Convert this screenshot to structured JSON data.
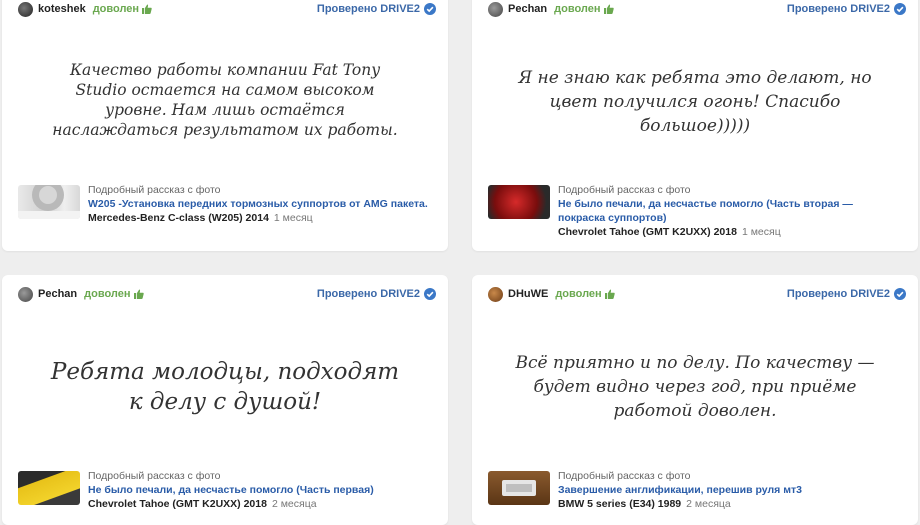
{
  "reviews": [
    {
      "user": "koteshek",
      "status": "доволен",
      "verified": "Проверено DRIVE2",
      "quote": "Качество работы компании Fat Tony Studio остается на самом высоком уровне. Нам лишь остаётся наслаждаться результатом их работы.",
      "post_label": "Подробный рассказ с фото",
      "post_title": "W205 -Установка передних тормозных суппортов от AMG пакета.",
      "car": "Mercedes-Benz C-class (W205) 2014",
      "time": "1 месяц"
    },
    {
      "user": "Pechan",
      "status": "доволен",
      "verified": "Проверено DRIVE2",
      "quote": "Я не знаю как ребята это делают, но цвет получился огонь! Спасибо большое)))))",
      "post_label": "Подробный рассказ с фото",
      "post_title": "Не было печали, да несчастье помогло (Часть вторая — покраска суппортов)",
      "car": "Chevrolet Tahoe (GMT K2UXX) 2018",
      "time": "1 месяц"
    },
    {
      "user": "Pechan",
      "status": "доволен",
      "verified": "Проверено DRIVE2",
      "quote": "Ребята молодцы, подходят к делу с душой!",
      "post_label": "Подробный рассказ с фото",
      "post_title": "Не было печали, да несчастье помогло (Часть первая)",
      "car": "Chevrolet Tahoe (GMT K2UXX) 2018",
      "time": "2 месяца"
    },
    {
      "user": "DHuWE",
      "status": "доволен",
      "verified": "Проверено DRIVE2",
      "quote": "Всё приятно и по делу. По качеству — будет видно через год, при приёме работой доволен.",
      "post_label": "Подробный рассказ с фото",
      "post_title": "Завершение англификации, перешив руля мт3",
      "car": "BMW 5 series (E34) 1989",
      "time": "2 месяца"
    }
  ],
  "colors": {
    "status": "#6aa84f",
    "link": "#2a5ca8",
    "verified_badge": "#3b78c7"
  },
  "icons": {
    "status": "thumbs-up-icon",
    "verified": "check-circle-icon"
  }
}
